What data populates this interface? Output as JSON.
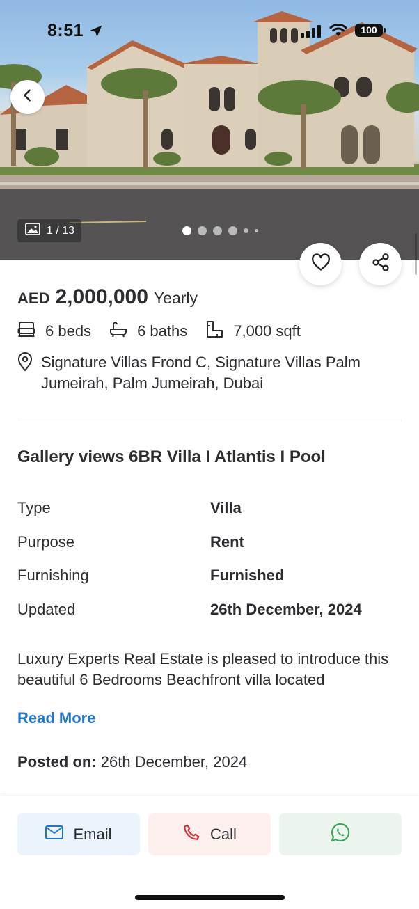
{
  "status_bar": {
    "time": "8:51",
    "battery": "100"
  },
  "gallery": {
    "counter": "1 / 13"
  },
  "listing": {
    "currency": "AED",
    "price": "2,000,000",
    "period": "Yearly",
    "beds": "6 beds",
    "baths": "6 baths",
    "area": "7,000 sqft",
    "address": "Signature Villas Frond C, Signature Villas Palm Jumeirah, Palm Jumeirah, Dubai",
    "title": "Gallery views 6BR Villa I Atlantis I Pool",
    "details": [
      {
        "label": "Type",
        "value": "Villa"
      },
      {
        "label": "Purpose",
        "value": "Rent"
      },
      {
        "label": "Furnishing",
        "value": "Furnished"
      },
      {
        "label": "Updated",
        "value": "26th December, 2024"
      }
    ],
    "description": "Luxury Experts Real Estate is pleased to introduce this beautiful 6 Bedrooms Beachfront villa located",
    "read_more": "Read More",
    "posted_label": "Posted on:",
    "posted_date": "26th December, 2024"
  },
  "actions": {
    "email": "Email",
    "call": "Call"
  },
  "colors": {
    "link": "#2277cc",
    "email_bg": "#ebf3fc",
    "call_bg": "#fdf0ef",
    "whatsapp_bg": "#ecf4ee",
    "call_icon": "#d32f2f",
    "whatsapp_icon": "#3aa55b"
  }
}
